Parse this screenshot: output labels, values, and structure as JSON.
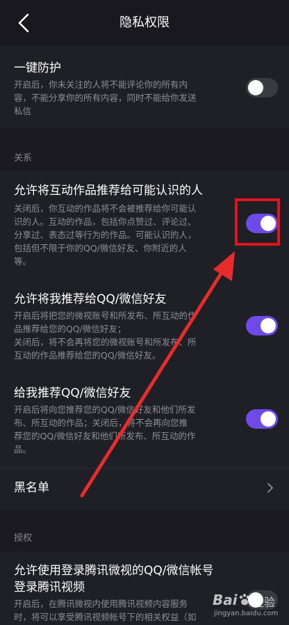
{
  "header": {
    "title": "隐私权限"
  },
  "one_click": {
    "title": "一键防护",
    "desc": "开启后，你未关注的人将不能评论你的所有内\n容，不能分享你的所有内容，同时不能给你发送\n私信",
    "state": "off"
  },
  "sections": {
    "relations": "关系",
    "auth": "授权"
  },
  "items": [
    {
      "title": "允许将互动作品推荐给可能认识的人",
      "desc": "关闭后，你互动的作品将不会被推荐给你可能认\n识的人。互动的作品，包括你点赞过、评论过、\n分享过、表态过等行为的作品。可能认识的人，\n包括但不限于你的QQ/微信好友、你附近的人\n等。",
      "state": "on"
    },
    {
      "title": "允许将我推荐给QQ/微信好友",
      "desc": "开启后将把您的微视账号和所发布、所互动的作\n品推荐给您的QQ/微信好友；\n关闭后，将不会再将您的微视账号和所发布、所\n互动的作品推荐给您的QQ/微信好友。",
      "state": "on"
    },
    {
      "title": "给我推荐QQ/微信好友",
      "desc": "开启后将向您推荐您的QQ/微信好友和他们所发\n布、所互动的作品；关闭后，将不会再向您推\n荐您的QQ/微信好友和他们所发布、所互动的作\n品。",
      "state": "on"
    }
  ],
  "blacklist": {
    "label": "黑名单"
  },
  "auth_item": {
    "title_line1": "允许使用登录腾讯微视的QQ/微信帐号",
    "title_line2": "登录腾讯视频",
    "desc": "开启后，在腾讯微视内使用腾讯视频内容服务\n时，将可以享受腾讯视频帐号下的相关权益（如",
    "state": "off"
  },
  "watermark": {
    "brand": "Bai",
    "brand2": "经验",
    "url": "jingyan.baidu.com"
  },
  "colors": {
    "accent": "#6e4ae8",
    "highlight": "#e2131f",
    "background": "#1a1a20",
    "card": "#1f1f26"
  }
}
